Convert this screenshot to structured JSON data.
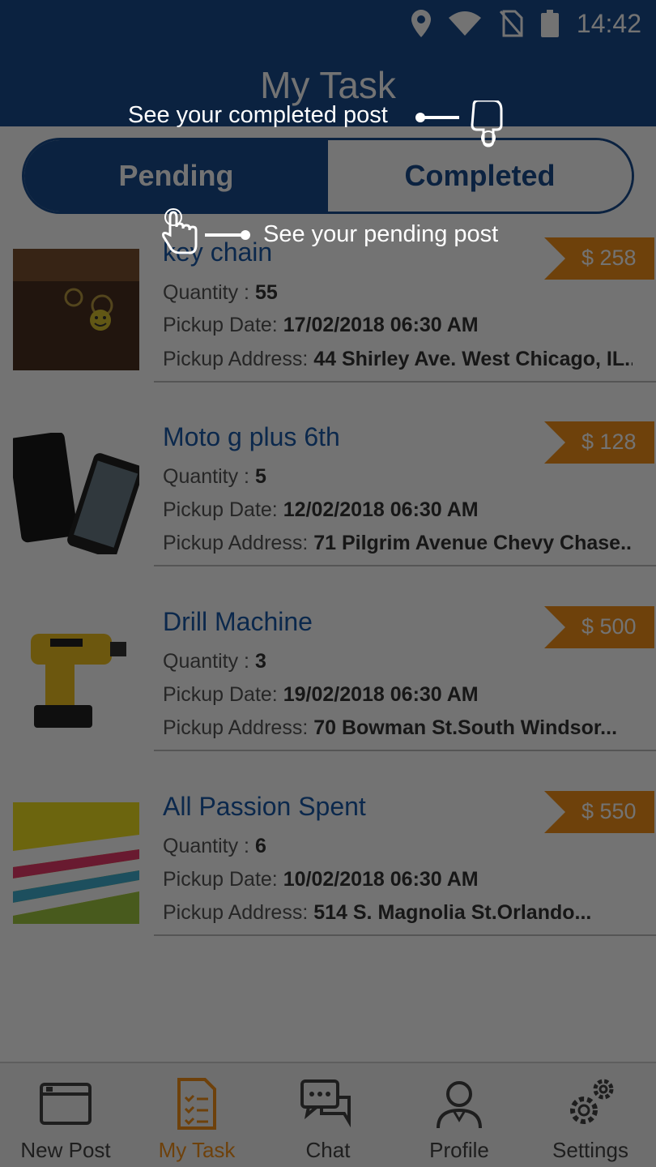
{
  "status_bar": {
    "time": "14:42"
  },
  "header": {
    "title": "My Task"
  },
  "tabs": {
    "pending": "Pending",
    "completed": "Completed"
  },
  "tasks": [
    {
      "title": "key chain",
      "quantity_label": "Quantity : ",
      "quantity": "55",
      "pickup_date_label": "Pickup Date: ",
      "pickup_date": "17/02/2018 06:30 AM",
      "pickup_address_label": "Pickup Address: ",
      "pickup_address": "44 Shirley Ave. West Chicago, IL...",
      "price": "$ 258",
      "image": "key-chain-photo"
    },
    {
      "title": "Moto g plus 6th",
      "quantity_label": "Quantity : ",
      "quantity": "5",
      "pickup_date_label": "Pickup Date: ",
      "pickup_date": "12/02/2018 06:30 AM",
      "pickup_address_label": "Pickup Address: ",
      "pickup_address": "71 Pilgrim Avenue Chevy Chase...",
      "price": "$ 128",
      "image": "phone-photo"
    },
    {
      "title": "Drill Machine",
      "quantity_label": "Quantity : ",
      "quantity": "3",
      "pickup_date_label": "Pickup Date: ",
      "pickup_date": "19/02/2018 06:30 AM",
      "pickup_address_label": "Pickup Address: ",
      "pickup_address": "70 Bowman St.South Windsor...",
      "price": "$ 500",
      "image": "drill-photo"
    },
    {
      "title": "All Passion Spent",
      "quantity_label": "Quantity : ",
      "quantity": "6",
      "pickup_date_label": "Pickup Date: ",
      "pickup_date": "10/02/2018 06:30 AM",
      "pickup_address_label": "Pickup Address: ",
      "pickup_address": "514 S. Magnolia St.Orlando...",
      "price": "$ 550",
      "image": "books-photo"
    }
  ],
  "bottom_nav": [
    {
      "label": "New Post",
      "icon": "new-post-icon"
    },
    {
      "label": "My Task",
      "icon": "task-clipboard-icon",
      "active": true
    },
    {
      "label": "Chat",
      "icon": "chat-bubbles-icon"
    },
    {
      "label": "Profile",
      "icon": "profile-icon"
    },
    {
      "label": "Settings",
      "icon": "settings-gears-icon"
    }
  ],
  "coach_marks": {
    "completed_hint": "See your completed post",
    "pending_hint": "See your pending post"
  },
  "colors": {
    "primary": "#1a4d8f",
    "accent": "#f39019",
    "title_blue": "#1a5aa8",
    "overlay": "rgba(0,0,0,0.55)"
  }
}
